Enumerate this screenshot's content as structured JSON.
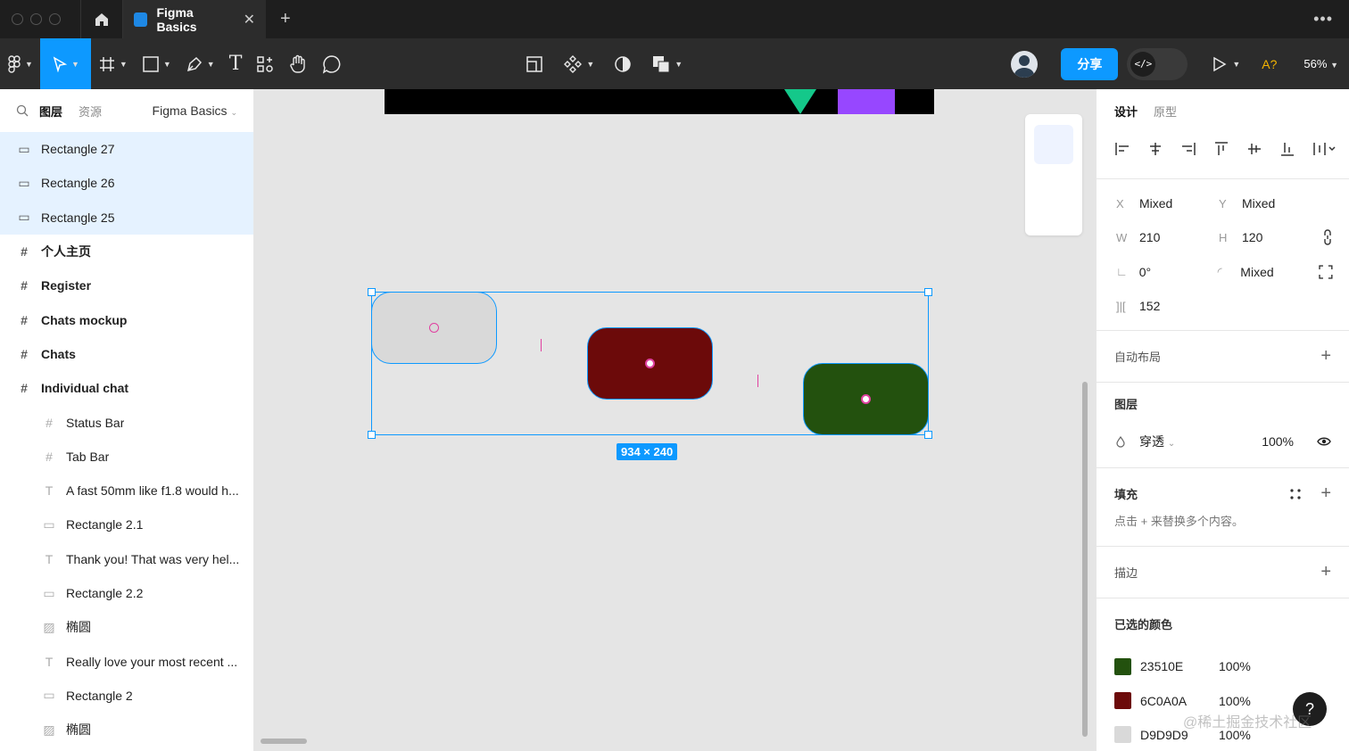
{
  "tabbar": {
    "file_tab_label": "Figma Basics",
    "close_glyph": "✕",
    "new_tab_glyph": "+",
    "more_glyph": "•••"
  },
  "toolbar": {
    "share_label": "分享",
    "devmode_glyph": "</>",
    "font_warning": "A?",
    "zoom": "56%",
    "text_tool_glyph": "T"
  },
  "left_panel": {
    "tab_layers": "图层",
    "tab_assets": "资源",
    "page_name": "Figma Basics",
    "layers": [
      {
        "label": "Rectangle 27",
        "kind": "rect",
        "selected": true,
        "child": false,
        "icon_glyph": "▭"
      },
      {
        "label": "Rectangle 26",
        "kind": "rect",
        "selected": true,
        "child": false,
        "icon_glyph": "▭"
      },
      {
        "label": "Rectangle 25",
        "kind": "rect",
        "selected": true,
        "child": false,
        "icon_glyph": "▭"
      },
      {
        "label": "个人主页",
        "kind": "frame",
        "selected": false,
        "child": false,
        "icon_glyph": "#"
      },
      {
        "label": "Register",
        "kind": "frame",
        "selected": false,
        "child": false,
        "icon_glyph": "#"
      },
      {
        "label": "Chats mockup",
        "kind": "frame",
        "selected": false,
        "child": false,
        "icon_glyph": "#"
      },
      {
        "label": "Chats",
        "kind": "frame",
        "selected": false,
        "child": false,
        "icon_glyph": "#"
      },
      {
        "label": "Individual chat",
        "kind": "frame",
        "selected": false,
        "child": false,
        "icon_glyph": "#"
      },
      {
        "label": "Status Bar",
        "kind": "frame",
        "selected": false,
        "child": true,
        "icon_glyph": "#"
      },
      {
        "label": "Tab Bar",
        "kind": "frame",
        "selected": false,
        "child": true,
        "icon_glyph": "#"
      },
      {
        "label": "A fast 50mm like f1.8 would h...",
        "kind": "text",
        "selected": false,
        "child": true,
        "icon_glyph": "T"
      },
      {
        "label": "Rectangle 2.1",
        "kind": "rect",
        "selected": false,
        "child": true,
        "icon_glyph": "▭"
      },
      {
        "label": "Thank you! That was very hel...",
        "kind": "text",
        "selected": false,
        "child": true,
        "icon_glyph": "T"
      },
      {
        "label": "Rectangle 2.2",
        "kind": "rect",
        "selected": false,
        "child": true,
        "icon_glyph": "▭"
      },
      {
        "label": "椭圆",
        "kind": "image",
        "selected": false,
        "child": true,
        "icon_glyph": "▨"
      },
      {
        "label": "Really love your most recent ...",
        "kind": "text",
        "selected": false,
        "child": true,
        "icon_glyph": "T"
      },
      {
        "label": "Rectangle 2",
        "kind": "rect",
        "selected": false,
        "child": true,
        "icon_glyph": "▭"
      },
      {
        "label": "椭圆",
        "kind": "image",
        "selected": false,
        "child": true,
        "icon_glyph": "▨"
      }
    ]
  },
  "canvas": {
    "selection_size": "934 × 240",
    "rectangles": [
      {
        "name": "Rectangle 25",
        "color": "#D9D9D9"
      },
      {
        "name": "Rectangle 26",
        "color": "#6C0A0A"
      },
      {
        "name": "Rectangle 27",
        "color": "#23510E"
      }
    ]
  },
  "right_panel": {
    "tab_design": "设计",
    "tab_prototype": "原型",
    "x_label": "X",
    "x_value": "Mixed",
    "y_label": "Y",
    "y_value": "Mixed",
    "w_label": "W",
    "w_value": "210",
    "h_label": "H",
    "h_value": "120",
    "rotation_label": "∟",
    "rotation_value": "0°",
    "radius_label": "◜",
    "radius_value": "Mixed",
    "spacing_label": "]|[",
    "spacing_value": "152",
    "auto_layout_title": "自动布局",
    "layer_title": "图层",
    "blend_mode": "穿透",
    "opacity": "100%",
    "fill_title": "填充",
    "fill_hint": "点击 + 来替换多个内容。",
    "stroke_title": "描边",
    "selected_colors_title": "已选的颜色",
    "plus_glyph": "+",
    "help_glyph": "?",
    "colors": [
      {
        "hex": "23510E",
        "opacity": "100%",
        "swatch": "#23510E"
      },
      {
        "hex": "6C0A0A",
        "opacity": "100%",
        "swatch": "#6C0A0A"
      },
      {
        "hex": "D9D9D9",
        "opacity": "100%",
        "swatch": "#D9D9D9"
      }
    ]
  },
  "watermark": "@稀土掘金技术社区"
}
